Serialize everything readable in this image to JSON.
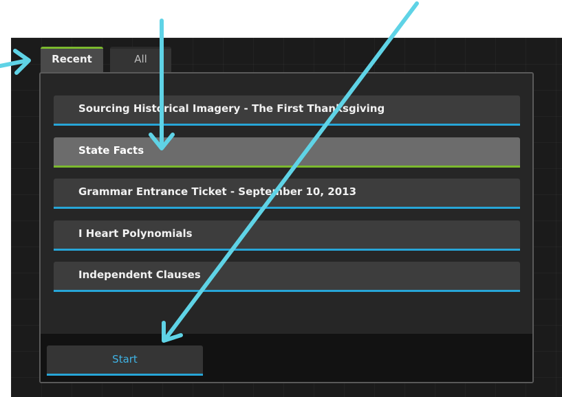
{
  "tabs": {
    "recent": "Recent",
    "all": "All"
  },
  "items": [
    "Sourcing Historical Imagery - The First Thanksgiving",
    "State Facts",
    "Grammar Entrance Ticket - September 10, 2013",
    "I Heart Polynomials",
    "Independent Clauses"
  ],
  "selected_index": 1,
  "start_label": "Start",
  "colors": {
    "accent_blue": "#27a6d8",
    "accent_green": "#7cba2e",
    "annotation_arrow": "#5fd3e6"
  }
}
